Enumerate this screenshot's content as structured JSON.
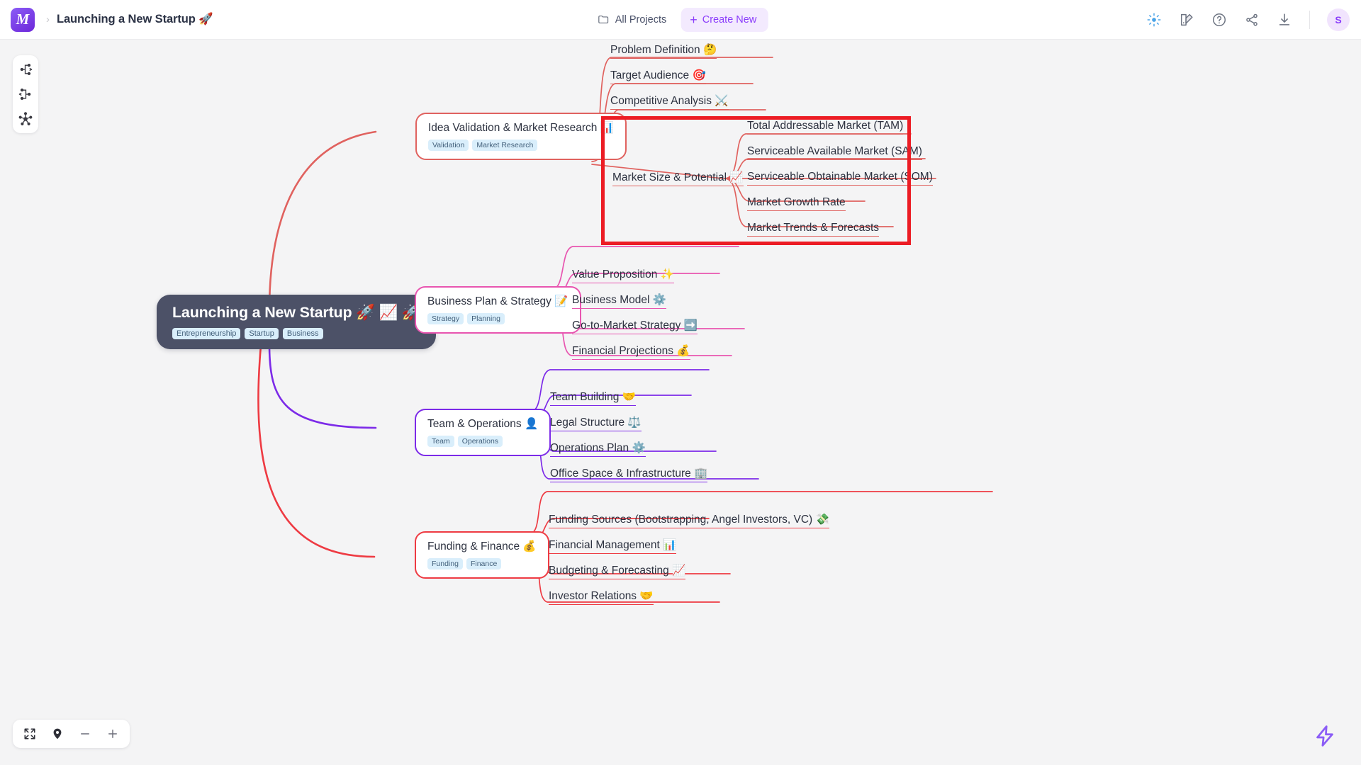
{
  "header": {
    "logo_letter": "M",
    "breadcrumb_separator": "›",
    "doc_title": "Launching a New Startup 🚀",
    "all_projects_label": "All Projects",
    "create_new_label": "Create New",
    "create_new_plus": "+",
    "avatar_initial": "S",
    "icons": {
      "folder": "folder-icon",
      "ai_sparkle": "ai-sparkle-icon",
      "theme": "theme-palette-icon",
      "help": "help-circle-icon",
      "share": "share-icon",
      "download": "download-icon"
    }
  },
  "left_toolbar": {
    "items": [
      {
        "name": "layout-right-tree",
        "label": "Right tree layout"
      },
      {
        "name": "layout-left-tree",
        "label": "Left tree layout"
      },
      {
        "name": "layout-radial",
        "label": "Radial layout"
      }
    ]
  },
  "zoom_controls": {
    "fit_label": "Fit to screen",
    "center_label": "Center view",
    "zoom_out_label": "−",
    "zoom_in_label": "+"
  },
  "bottom_right": {
    "bolt_label": "quick-actions"
  },
  "colors": {
    "accent_purple": "#8b5cf6",
    "branch_coral": "#e0625f",
    "branch_pink": "#e855b0",
    "branch_purple": "#7c2ae8",
    "branch_red": "#ee3b43",
    "root_bg": "#4c5167",
    "highlight_red": "#ec1c24",
    "tag_bg": "#d9eefb",
    "canvas_bg": "#f4f4f5"
  },
  "mindmap": {
    "root": {
      "title": "Launching a New Startup 🚀 📈 🚀",
      "tags": [
        "Entrepreneurship",
        "Startup",
        "Business"
      ]
    },
    "branches": [
      {
        "id": "idea-validation",
        "title": "Idea Validation & Market Research 📊",
        "tags": [
          "Validation",
          "Market Research"
        ],
        "color": "#e0625f",
        "children": [
          {
            "label": "Problem Definition 🤔"
          },
          {
            "label": "Target Audience 🎯"
          },
          {
            "label": "Competitive Analysis ⚔️"
          },
          {
            "label": "Market Size & Potential 📈",
            "highlighted": true,
            "children": [
              {
                "label": "Total Addressable Market (TAM)"
              },
              {
                "label": "Serviceable Available Market (SAM)"
              },
              {
                "label": "Serviceable Obtainable Market (SOM)"
              },
              {
                "label": "Market Growth Rate"
              },
              {
                "label": "Market Trends & Forecasts"
              }
            ]
          }
        ]
      },
      {
        "id": "business-plan",
        "title": "Business Plan & Strategy 📝",
        "tags": [
          "Strategy",
          "Planning"
        ],
        "color": "#e855b0",
        "children": [
          {
            "label": "Value Proposition ✨"
          },
          {
            "label": "Business Model ⚙️"
          },
          {
            "label": "Go-to-Market Strategy ➡️"
          },
          {
            "label": "Financial Projections 💰"
          }
        ]
      },
      {
        "id": "team-operations",
        "title": "Team & Operations 👤",
        "tags": [
          "Team",
          "Operations"
        ],
        "color": "#7c2ae8",
        "children": [
          {
            "label": "Team Building 🤝"
          },
          {
            "label": "Legal Structure ⚖️"
          },
          {
            "label": "Operations Plan ⚙️"
          },
          {
            "label": "Office Space & Infrastructure 🏢"
          }
        ]
      },
      {
        "id": "funding-finance",
        "title": "Funding & Finance 💰",
        "tags": [
          "Funding",
          "Finance"
        ],
        "color": "#ee3b43",
        "children": [
          {
            "label": "Funding Sources (Bootstrapping, Angel Investors, VC) 💸"
          },
          {
            "label": "Financial Management 📊"
          },
          {
            "label": "Budgeting & Forecasting 📈"
          },
          {
            "label": "Investor Relations 🤝"
          }
        ]
      }
    ]
  }
}
